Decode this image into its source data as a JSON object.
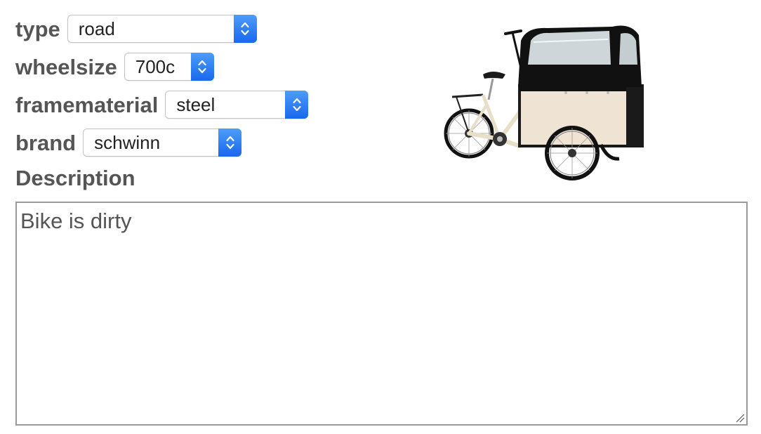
{
  "form": {
    "type": {
      "label": "type",
      "value": "road"
    },
    "wheelsize": {
      "label": "wheelsize",
      "value": "700c"
    },
    "framematerial": {
      "label": "framematerial",
      "value": "steel"
    },
    "brand": {
      "label": "brand",
      "value": "schwinn"
    }
  },
  "description": {
    "label": "Description",
    "value": "Bike is dirty"
  },
  "colors": {
    "accent": "#1f6ff0",
    "label_text": "#555555"
  },
  "icons": {
    "select_arrows": "chevron-up-down-icon",
    "resize": "resize-handle-icon"
  }
}
